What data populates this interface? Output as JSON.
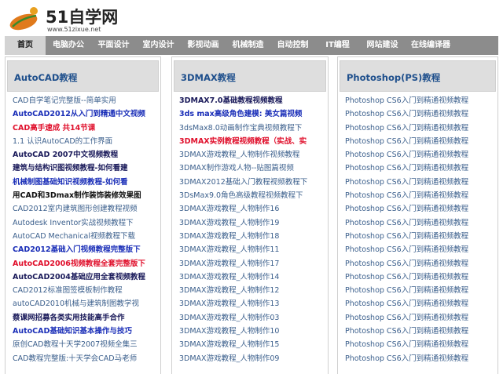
{
  "site": {
    "logo_text": "51自学网",
    "url": "www.51zixue.net",
    "brand_colors": {
      "leaf": "#e07a1c",
      "dot": "#e8a020",
      "stem": "#3a8a2a"
    }
  },
  "nav": {
    "items": [
      {
        "label": "首页",
        "active": true
      },
      {
        "label": "电脑办公"
      },
      {
        "label": "平面设计"
      },
      {
        "label": "室内设计"
      },
      {
        "label": "影视动画"
      },
      {
        "label": "机械制造"
      },
      {
        "label": "自动控制"
      },
      {
        "label": "IT编程"
      },
      {
        "label": "网站建设"
      },
      {
        "label": "在线编译器"
      }
    ]
  },
  "columns": [
    {
      "title": "AutoCAD教程",
      "links": [
        {
          "text": "CAD自学笔记完整版--简单实用",
          "style": "normal"
        },
        {
          "text": "AutoCAD2012从入门到精通中文视频",
          "style": "bold blue"
        },
        {
          "text": "CAD高手速成 共14节课",
          "style": "bold red"
        },
        {
          "text": "1.1 认识AutoCAD的工作界面",
          "style": "normal"
        },
        {
          "text": "AutoCAD 2007中文视频教程",
          "style": "bold dark"
        },
        {
          "text": "建筑与结构识图视频教程-如何看建",
          "style": "bold dark"
        },
        {
          "text": "机械制图基础知识视频教程-如何看",
          "style": "bold blue"
        },
        {
          "text": "用CAD和3Dmax制作装饰装修效果图",
          "style": "bold black"
        },
        {
          "text": "CAD2012室内建筑图形创建教程视频",
          "style": "normal"
        },
        {
          "text": "Autodesk Inventor实战视频教程下",
          "style": "normal"
        },
        {
          "text": "AutoCAD Mechanical视频教程下载",
          "style": "normal"
        },
        {
          "text": "CAD2012基础入门视频教程完整版下",
          "style": "bold blue"
        },
        {
          "text": "AutoCAD2006视频教程全套完整版下",
          "style": "bold red"
        },
        {
          "text": "AutoCAD2004基础应用全套视频教程",
          "style": "bold dark"
        },
        {
          "text": "CAD2012标准图签模板制作教程",
          "style": "normal"
        },
        {
          "text": "autoCAD2010机械与建筑制图教学视",
          "style": "normal"
        },
        {
          "text": "蔡课网招募各类实用技能高手合作",
          "style": "bold dark"
        },
        {
          "text": "AutoCAD基础知识基本操作与技巧",
          "style": "bold blue"
        },
        {
          "text": "原创CAD教程十天学2007视频全集三",
          "style": "normal"
        },
        {
          "text": "CAD教程完整版:十天学会CAD马老师",
          "style": "normal"
        }
      ]
    },
    {
      "title": "3DMAX教程",
      "links": [
        {
          "text": "3DMAX7.0基础教程视频教程",
          "style": "bold dark"
        },
        {
          "text": "3ds max高级角色建模: 美女篇视频",
          "style": "bold blue"
        },
        {
          "text": "3dsMax8.0动画制作宝典视频教程下",
          "style": "normal"
        },
        {
          "text": "3DMAX实例教程视频教程（实战、实",
          "style": "bold red"
        },
        {
          "text": "3DMAX游戏教程_人物制作视频教程",
          "style": "normal"
        },
        {
          "text": "3DMAX制作游戏人物--贴图篇视频",
          "style": "normal"
        },
        {
          "text": "3DMAX2012基础入门教程视频教程下",
          "style": "normal"
        },
        {
          "text": "3DsMax9.0角色高级教程视频教程下",
          "style": "normal"
        },
        {
          "text": "3DMAX游戏教程_人物制作16",
          "style": "normal"
        },
        {
          "text": "3DMAX游戏教程_人物制作19",
          "style": "normal"
        },
        {
          "text": "3DMAX游戏教程_人物制作18",
          "style": "normal"
        },
        {
          "text": "3DMAX游戏教程_人物制作11",
          "style": "normal"
        },
        {
          "text": "3DMAX游戏教程_人物制作17",
          "style": "normal"
        },
        {
          "text": "3DMAX游戏教程_人物制作14",
          "style": "normal"
        },
        {
          "text": "3DMAX游戏教程_人物制作12",
          "style": "normal"
        },
        {
          "text": "3DMAX游戏教程_人物制作13",
          "style": "normal"
        },
        {
          "text": "3DMAX游戏教程_人物制作03",
          "style": "normal"
        },
        {
          "text": "3DMAX游戏教程_人物制作10",
          "style": "normal"
        },
        {
          "text": "3DMAX游戏教程_人物制作15",
          "style": "normal"
        },
        {
          "text": "3DMAX游戏教程_人物制作09",
          "style": "normal"
        }
      ]
    },
    {
      "title": "Photoshop(PS)教程",
      "links": [
        {
          "text": "Photoshop CS6入门到精通视频教程",
          "style": "normal"
        },
        {
          "text": "Photoshop CS6入门到精通视频教程",
          "style": "normal"
        },
        {
          "text": "Photoshop CS6入门到精通视频教程",
          "style": "normal"
        },
        {
          "text": "Photoshop CS6入门到精通视频教程",
          "style": "normal"
        },
        {
          "text": "Photoshop CS6入门到精通视频教程",
          "style": "normal"
        },
        {
          "text": "Photoshop CS6入门到精通视频教程",
          "style": "normal"
        },
        {
          "text": "Photoshop CS6入门到精通视频教程",
          "style": "normal"
        },
        {
          "text": "Photoshop CS6入门到精通视频教程",
          "style": "normal"
        },
        {
          "text": "Photoshop CS6入门到精通视频教程",
          "style": "normal"
        },
        {
          "text": "Photoshop CS6入门到精通视频教程",
          "style": "normal"
        },
        {
          "text": "Photoshop CS6入门到精通视频教程",
          "style": "normal"
        },
        {
          "text": "Photoshop CS6入门到精通视频教程",
          "style": "normal"
        },
        {
          "text": "Photoshop CS6入门到精通视频教程",
          "style": "normal"
        },
        {
          "text": "Photoshop CS6入门到精通视频教程",
          "style": "normal"
        },
        {
          "text": "Photoshop CS6入门到精通视频教程",
          "style": "normal"
        },
        {
          "text": "Photoshop CS6入门到精通视频教程",
          "style": "normal"
        },
        {
          "text": "Photoshop CS6入门到精通视频教程",
          "style": "normal"
        },
        {
          "text": "Photoshop CS6入门到精通视频教程",
          "style": "normal"
        },
        {
          "text": "Photoshop CS6入门到精通视频教程",
          "style": "normal"
        },
        {
          "text": "Photoshop CS6入门到精通视频教程",
          "style": "normal"
        }
      ]
    }
  ]
}
